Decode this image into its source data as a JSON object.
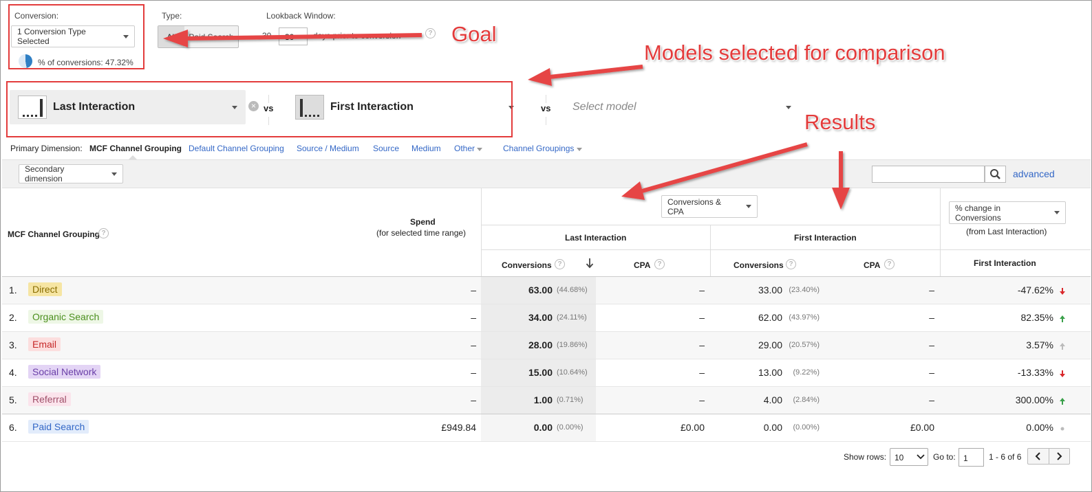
{
  "conversion": {
    "label": "Conversion:",
    "dropdown": "1 Conversion Type Selected",
    "pct_text": "% of conversions: 47.32%"
  },
  "type": {
    "label": "Type:",
    "value": "All",
    "partial": "Paid Search"
  },
  "lookback": {
    "label": "Lookback Window:",
    "prefix": "30",
    "value": "30",
    "suffix": "days prior to conversion"
  },
  "annotations": {
    "goal": "Goal",
    "models": "Models selected for comparison",
    "results": "Results"
  },
  "models": {
    "model1": "Last Interaction",
    "vs1": "vs",
    "model2": "First Interaction",
    "vs2": "vs",
    "placeholder": "Select model"
  },
  "dimension": {
    "label": "Primary Dimension:",
    "active": "MCF Channel Grouping",
    "links": [
      "Default Channel Grouping",
      "Source / Medium",
      "Source",
      "Medium",
      "Other",
      "Channel Groupings"
    ]
  },
  "toolbar": {
    "secondary": "Secondary dimension",
    "advanced": "advanced"
  },
  "table": {
    "col_channel": "MCF Channel Grouping",
    "col_spend": "Spend",
    "col_spend_sub": "(for selected time range)",
    "metric_dropdown": "Conversions & CPA",
    "change_dropdown": "% change in Conversions",
    "change_sub": "(from Last Interaction)",
    "group_last": "Last Interaction",
    "group_first": "First Interaction",
    "conv": "Conversions",
    "cpa": "CPA",
    "change_col": "First Interaction",
    "rows": [
      {
        "num": "1.",
        "channel": "Direct",
        "spend": "–",
        "last_conv": "63.00",
        "last_pct": "(44.68%)",
        "last_cpa": "–",
        "first_conv": "33.00",
        "first_pct": "(23.40%)",
        "first_cpa": "–",
        "change": "-47.62%"
      },
      {
        "num": "2.",
        "channel": "Organic Search",
        "spend": "–",
        "last_conv": "34.00",
        "last_pct": "(24.11%)",
        "last_cpa": "–",
        "first_conv": "62.00",
        "first_pct": "(43.97%)",
        "first_cpa": "–",
        "change": "82.35%"
      },
      {
        "num": "3.",
        "channel": "Email",
        "spend": "–",
        "last_conv": "28.00",
        "last_pct": "(19.86%)",
        "last_cpa": "–",
        "first_conv": "29.00",
        "first_pct": "(20.57%)",
        "first_cpa": "–",
        "change": "3.57%"
      },
      {
        "num": "4.",
        "channel": "Social Network",
        "spend": "–",
        "last_conv": "15.00",
        "last_pct": "(10.64%)",
        "last_cpa": "–",
        "first_conv": "13.00",
        "first_pct": "(9.22%)",
        "first_cpa": "–",
        "change": "-13.33%"
      },
      {
        "num": "5.",
        "channel": "Referral",
        "spend": "–",
        "last_conv": "1.00",
        "last_pct": "(0.71%)",
        "last_cpa": "–",
        "first_conv": "4.00",
        "first_pct": "(2.84%)",
        "first_cpa": "–",
        "change": "300.00%"
      },
      {
        "num": "6.",
        "channel": "Paid Search",
        "spend": "£949.84",
        "last_conv": "0.00",
        "last_pct": "(0.00%)",
        "last_cpa": "£0.00",
        "first_conv": "0.00",
        "first_pct": "(0.00%)",
        "first_cpa": "£0.00",
        "change": "0.00%"
      }
    ]
  },
  "pagination": {
    "show_rows": "Show rows:",
    "rows_value": "10",
    "goto": "Go to:",
    "goto_value": "1",
    "range": "1 - 6 of 6"
  },
  "colors": {
    "annotation": "#e33b3b",
    "link": "#3367c6",
    "up": "#3aa04a",
    "down": "#d9272b",
    "direct_bg": "#f6e5a3",
    "direct_fg": "#8a6d00",
    "organic_bg": "#eef7e6",
    "organic_fg": "#4b8f1e",
    "email_bg": "#fcdede",
    "email_fg": "#c62828",
    "social_bg": "#e3d4f5",
    "social_fg": "#6a3fa8",
    "referral_bg": "#fbe4ec",
    "referral_fg": "#a0506a",
    "paid_bg": "#e2ecfb",
    "paid_fg": "#3367c6"
  }
}
